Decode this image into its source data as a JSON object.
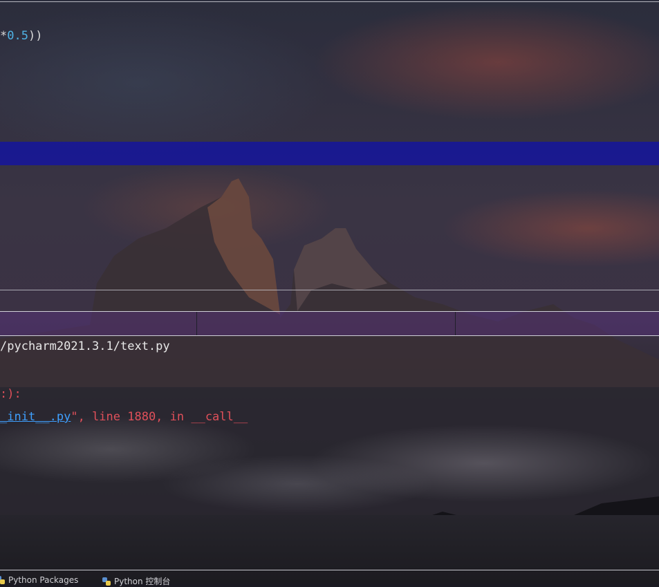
{
  "editor": {
    "line_prefix": "*",
    "line_number": "0.5",
    "line_suffix": "))"
  },
  "console": {
    "path_text": "/pycharm2021.3.1/text.py",
    "traceback_head": ":):",
    "traceback_file": "_init__.py",
    "traceback_rest": "\", line 1880, in __call__"
  },
  "bottom_bar": {
    "packages_label": "Python Packages",
    "console_label": "Python 控制台"
  }
}
